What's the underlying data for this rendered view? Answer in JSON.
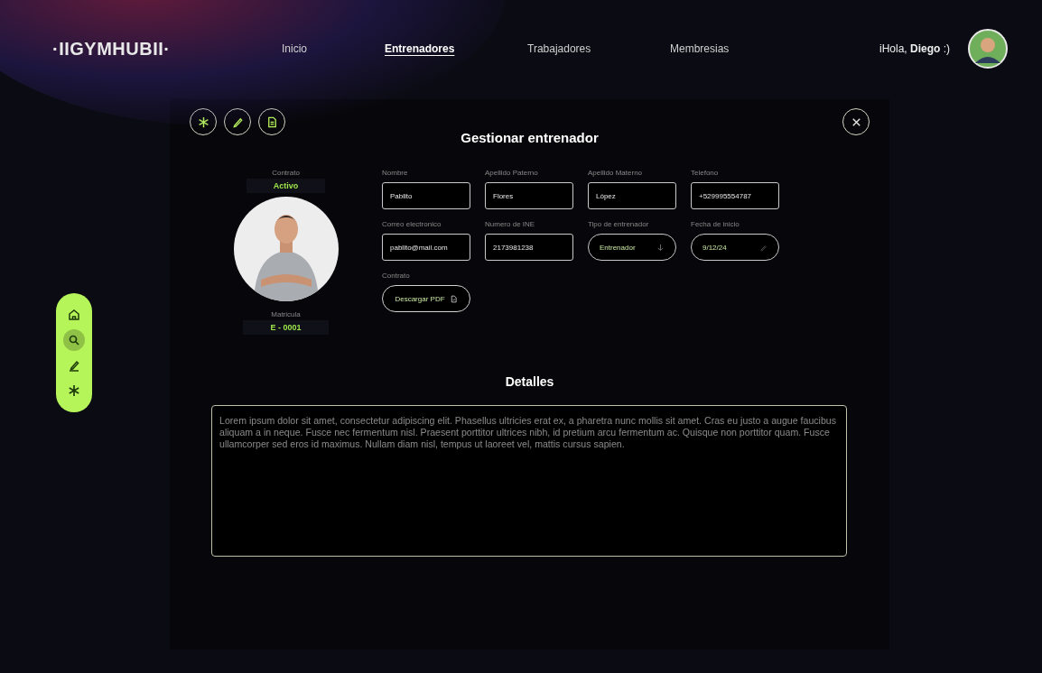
{
  "header": {
    "logo": "·IIGYMHUBII·",
    "nav": [
      {
        "label": "Inicio",
        "selected": false
      },
      {
        "label": "Entrenadores",
        "selected": true
      },
      {
        "label": "Trabajadores",
        "selected": false
      },
      {
        "label": "Membresias",
        "selected": false
      }
    ],
    "greeting": "iHola, **Diego** :)"
  },
  "sidebar": {
    "items": [
      {
        "kind": "home",
        "selected": false
      },
      {
        "kind": "search",
        "selected": true
      },
      {
        "kind": "edit",
        "selected": false
      },
      {
        "kind": "snowflake",
        "selected": false
      }
    ]
  },
  "modal": {
    "toolbar": [
      {
        "kind": "snowflake"
      },
      {
        "kind": "edit"
      },
      {
        "kind": "document"
      }
    ],
    "title": "Gestionar entrenador",
    "contract_label": "Contrato",
    "contract_status": "Activo",
    "id_label": "Matricula",
    "id_value": "E - 0001",
    "fields": [
      {
        "kind": "text",
        "label": "Nombre",
        "value": "Pablito"
      },
      {
        "kind": "text",
        "label": "Apellido Paterno",
        "value": "Flores"
      },
      {
        "kind": "text",
        "label": "Apellido Materno",
        "value": "López"
      },
      {
        "kind": "text",
        "label": "Telefono",
        "value": "+529995554787"
      },
      {
        "kind": "text",
        "label": "Correo electronico",
        "value": "pablito@mail.com"
      },
      {
        "kind": "text",
        "label": "Numero de INE",
        "value": "2173981238"
      },
      {
        "kind": "select",
        "label": "Tipo de entrenador",
        "value": "Entrenador"
      },
      {
        "kind": "date",
        "label": "Fecha de inicio",
        "value": "9/12/24"
      }
    ],
    "contract_file_label": "Contrato",
    "download_button": "Descargar PDF",
    "details_title": "Detalles",
    "details": "Lorem ipsum dolor sit amet, consectetur adipiscing elit. Phasellus ultricies erat ex, a pharetra nunc mollis sit amet. Cras eu justo a augue faucibus aliquam a in neque. Fusce nec fermentum nisl. Praesent porttitor ultrices nibh, id pretium arcu fermentum ac. Quisque non porttitor quam. Fusce ullamcorper sed eros id maximus. Nullam diam nisl, tempus ut laoreet vel, mattis cursus sapien."
  }
}
